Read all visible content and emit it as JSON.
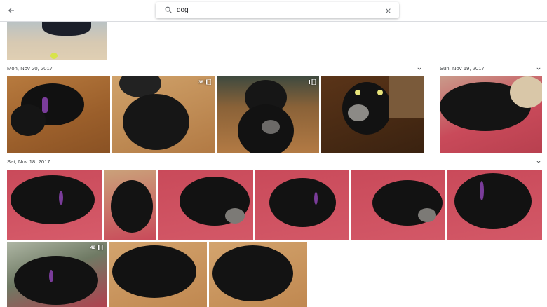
{
  "search": {
    "query": "dog"
  },
  "sections": [
    {
      "date": "Mon, Nov 20, 2017"
    },
    {
      "date": "Sun, Nov 19, 2017"
    },
    {
      "date": "Sat, Nov 18, 2017"
    }
  ],
  "badges": {
    "p2": "38",
    "p3": "",
    "p11": "42"
  },
  "icons": {
    "back": "arrow-back-icon",
    "search": "search-icon",
    "clear": "close-icon",
    "expand": "chevron-down-icon",
    "motion": "motion-photo-icon"
  },
  "colors": {
    "accent": "#1a73e8",
    "text": "#3c4043",
    "divider": "#dadce0",
    "cushion": "#c94a5a",
    "floor": "#c98a4a"
  }
}
